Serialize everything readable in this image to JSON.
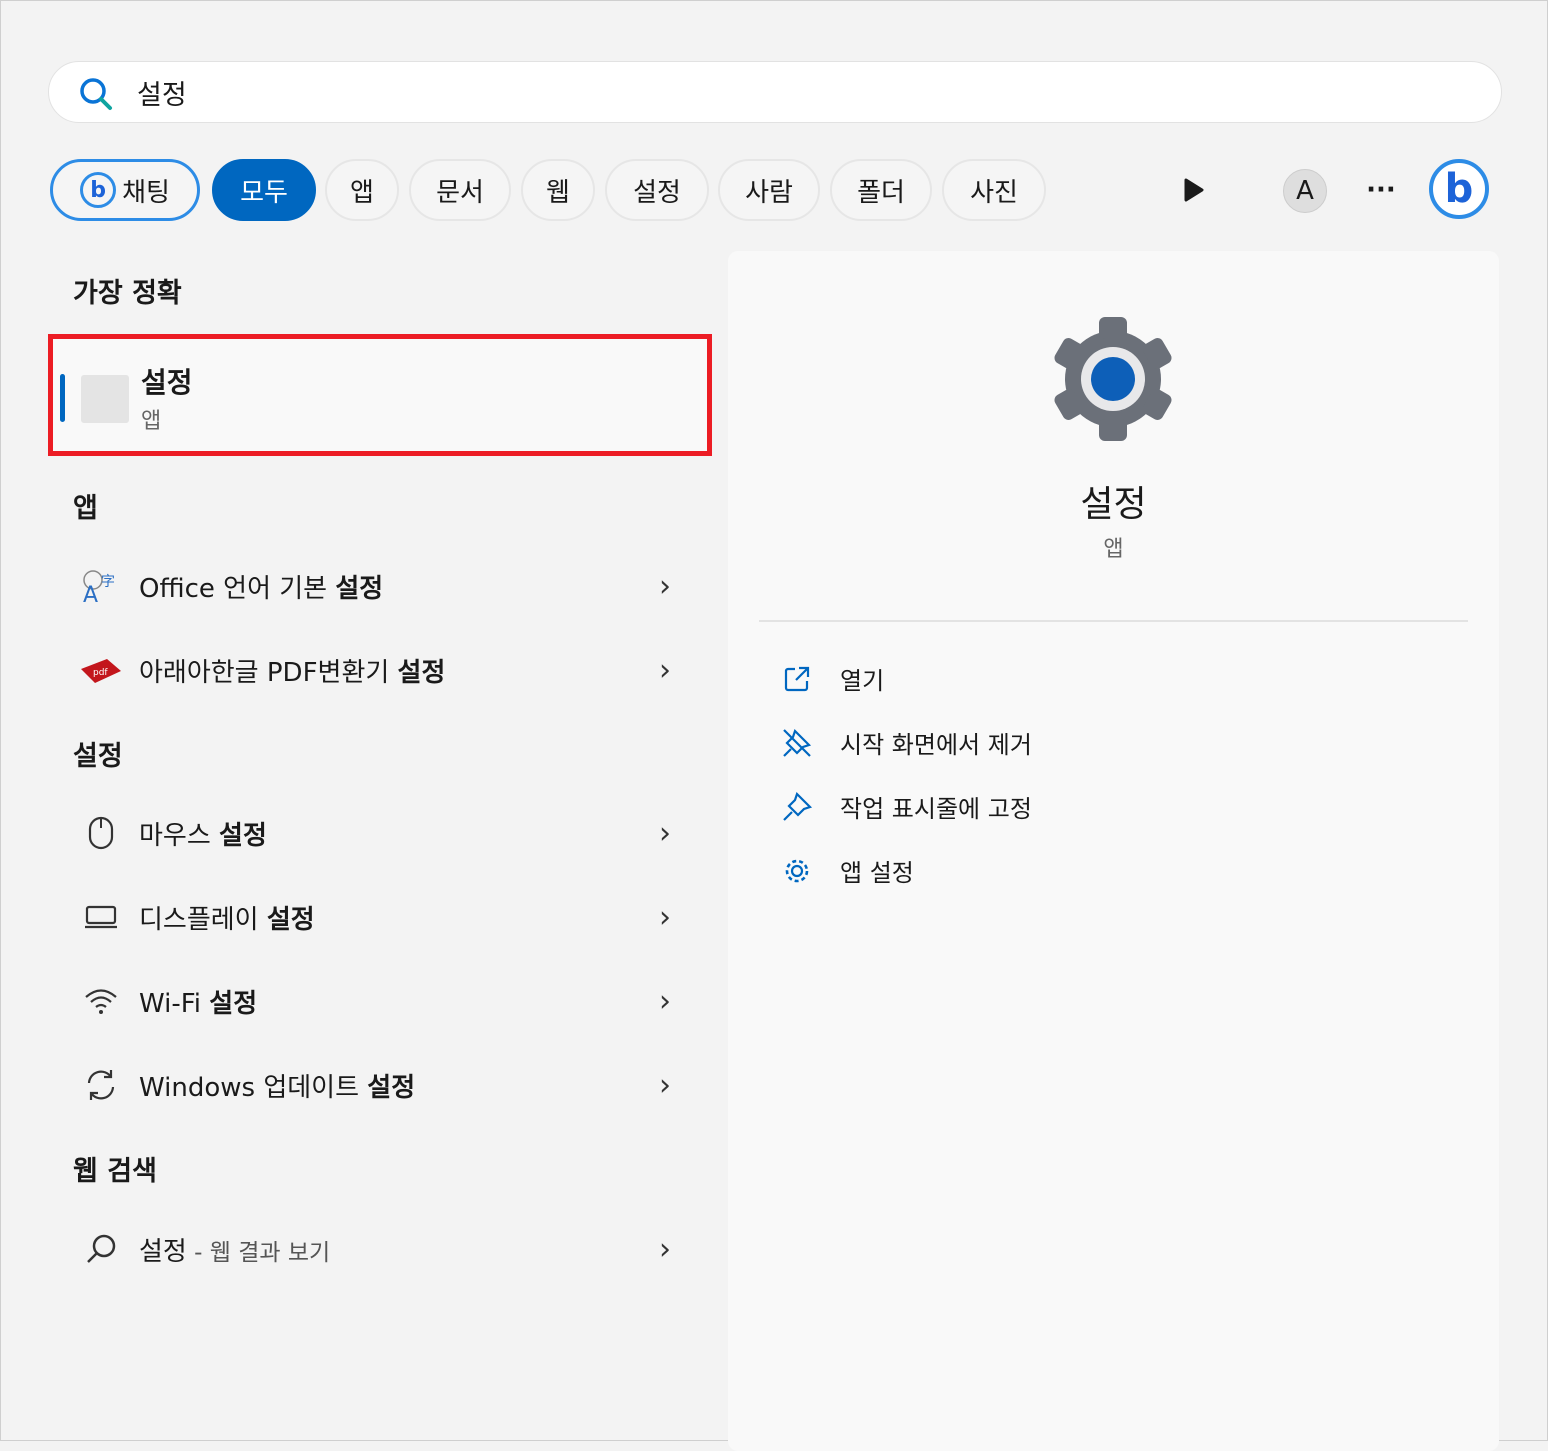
{
  "search": {
    "value": "설정"
  },
  "filters": {
    "chat": "채팅",
    "items": [
      "모두",
      "앱",
      "문서",
      "웹",
      "설정",
      "사람",
      "폴더",
      "사진"
    ],
    "active": "모두",
    "account_initial": "A"
  },
  "best_match": {
    "heading": "가장 정확",
    "title": "설정",
    "subtitle": "앱"
  },
  "apps": {
    "heading": "앱",
    "items": [
      {
        "pre": "Office 언어 기본 ",
        "bold": "설정",
        "icon": "office-language-icon"
      },
      {
        "pre": "아래아한글 PDF변환기 ",
        "bold": "설정",
        "icon": "pdf-icon"
      }
    ]
  },
  "settings": {
    "heading": "설정",
    "items": [
      {
        "pre": "마우스 ",
        "bold": "설정",
        "icon": "mouse-icon"
      },
      {
        "pre": "디스플레이 ",
        "bold": "설정",
        "icon": "display-icon"
      },
      {
        "pre": "Wi-Fi ",
        "bold": "설정",
        "icon": "wifi-icon"
      },
      {
        "pre": "Windows 업데이트 ",
        "bold": "설정",
        "icon": "update-icon"
      }
    ]
  },
  "web": {
    "heading": "웹 검색",
    "query": "설정",
    "suffix": " - 웹 결과 보기"
  },
  "preview": {
    "title": "설정",
    "subtitle": "앱",
    "actions": [
      "열기",
      "시작 화면에서 제거",
      "작업 표시줄에 고정",
      "앱 설정"
    ]
  },
  "colors": {
    "accent": "#0067c0",
    "highlight": "#ec1c24"
  }
}
